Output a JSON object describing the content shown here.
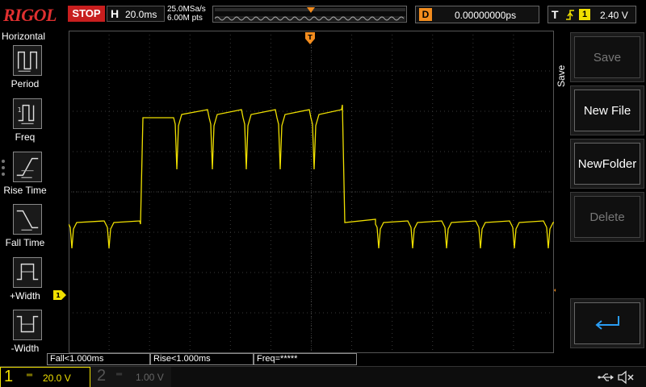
{
  "header": {
    "brand": "RIGOL",
    "run_state": "STOP",
    "horizontal": {
      "label": "H",
      "timebase": "20.0ms"
    },
    "acquisition": {
      "sample_rate": "25.0MSa/s",
      "memory_depth": "6.00M pts"
    },
    "delay": {
      "label": "D",
      "value": "0.00000000ps"
    },
    "trigger": {
      "label": "T",
      "source": "1",
      "level": "2.40 V"
    }
  },
  "left_menu": {
    "title": "Horizontal",
    "items": [
      {
        "label": "Period"
      },
      {
        "label": "Freq"
      },
      {
        "label": "Rise Time"
      },
      {
        "label": "Fall Time"
      },
      {
        "label": "+Width"
      },
      {
        "label": "-Width"
      }
    ]
  },
  "right_menu": {
    "title": "Save",
    "buttons": [
      {
        "label": "Save",
        "enabled": false
      },
      {
        "label": "New File",
        "enabled": true
      },
      {
        "label": "NewFolder",
        "enabled": true
      },
      {
        "label": "Delete",
        "enabled": false
      }
    ]
  },
  "measurements": [
    {
      "label": "Fall<1.000ms"
    },
    {
      "label": "Rise<1.000ms"
    },
    {
      "label": "Freq=*****"
    }
  ],
  "channels": {
    "ch1": {
      "number": "1",
      "scale": "20.0 V",
      "color": "#f0e000",
      "ground_marker": "1"
    },
    "ch2": {
      "number": "2",
      "scale": "1.00 V",
      "color": "#5a5a5a"
    }
  },
  "trigger_markers": {
    "top": "T",
    "right": "T"
  },
  "colors": {
    "trace": "#f0e000",
    "trigger": "#f28c1e",
    "grid": "#3a3a3a",
    "stop": "#c81e1e"
  }
}
